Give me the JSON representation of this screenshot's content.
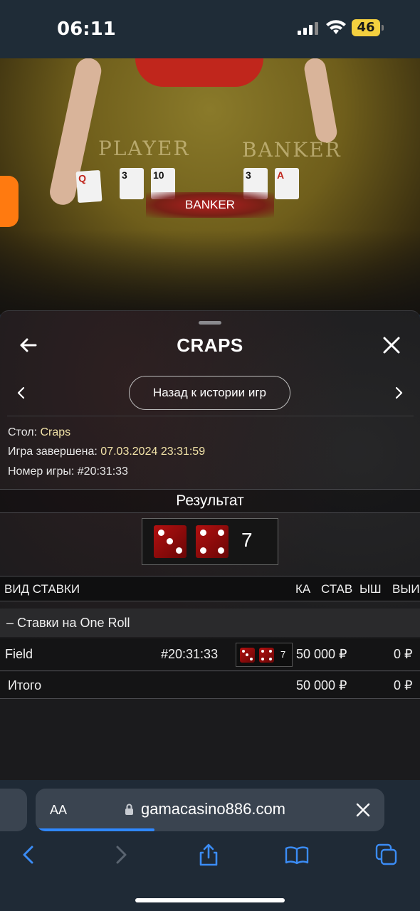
{
  "status_bar": {
    "time": "06:11",
    "battery": "46"
  },
  "video": {
    "player_label": "PLAYER",
    "banker_label": "BANKER",
    "result_tag": "BANKER",
    "player_cards": [
      "Q",
      "3",
      "10"
    ],
    "banker_cards": [
      "3",
      "A"
    ]
  },
  "panel": {
    "title": "CRAPS",
    "history_button": "Назад к истории игр",
    "table_label": "Стол: ",
    "table_value": "Craps",
    "finished_label": "Игра завершена: ",
    "finished_value": "07.03.2024 23:31:59",
    "game_number_label": "Номер игры: ",
    "game_number_value": "#20:31:33",
    "result_title": "Результат",
    "result_sum": "7",
    "dice": [
      3,
      4
    ]
  },
  "bets_table": {
    "headers": [
      "ВИД СТАВКИ",
      "КА",
      "СТАВ",
      "ЫШ",
      "ВЫИ"
    ],
    "group_label": "– Ставки на One Roll",
    "rows": [
      {
        "type": "Field",
        "game": "#20:31:33",
        "dice": [
          3,
          4
        ],
        "sum": "7",
        "stake": "50 000 ₽",
        "win": "0 ₽"
      }
    ],
    "total": {
      "label": "Итого",
      "stake": "50 000 ₽",
      "win": "0 ₽"
    }
  },
  "browser": {
    "aa": "AA",
    "url": "gamacasino886.com",
    "load_progress": 0.34
  },
  "colors": {
    "highlight_value": "#f2e3a8",
    "die_red": "#b21010",
    "accent_orange": "#ff7a10",
    "progress_blue": "#2f88ff"
  }
}
